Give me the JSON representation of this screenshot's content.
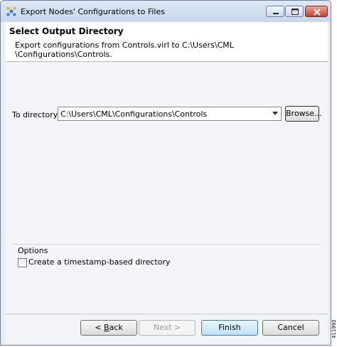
{
  "window": {
    "title": "Export Nodes' Configurations to Files",
    "controls": [
      "minimize",
      "maximize",
      "close"
    ]
  },
  "banner": {
    "title": "Select Output Directory",
    "message_line1": "Export configurations from Controls.virl to C:\\Users\\CML",
    "message_line2": "\\Configurations\\Controls."
  },
  "form": {
    "directory_label": "To directory:",
    "directory_value": "C:\\Users\\CML\\Configurations\\Controls",
    "browse_label": "Browse..."
  },
  "options": {
    "group_label": "Options",
    "timestamp_checkbox_label": "Create a timestamp-based directory",
    "timestamp_checked": false
  },
  "footer": {
    "back_arrow": "< ",
    "back_underlined": "B",
    "back_rest": "ack",
    "next_label": "Next >",
    "finish_label": "Finish",
    "cancel_label": "Cancel"
  },
  "side_tag": "411992",
  "colors": {
    "titlebar": "#c7d7ec",
    "window_bg": "#e8edf5",
    "close_button": "#c4412f",
    "finish_button": "#bfe0f6"
  },
  "icons": [
    "app-icon",
    "minimize-icon",
    "maximize-icon",
    "close-icon",
    "dropdown-arrow-icon"
  ]
}
